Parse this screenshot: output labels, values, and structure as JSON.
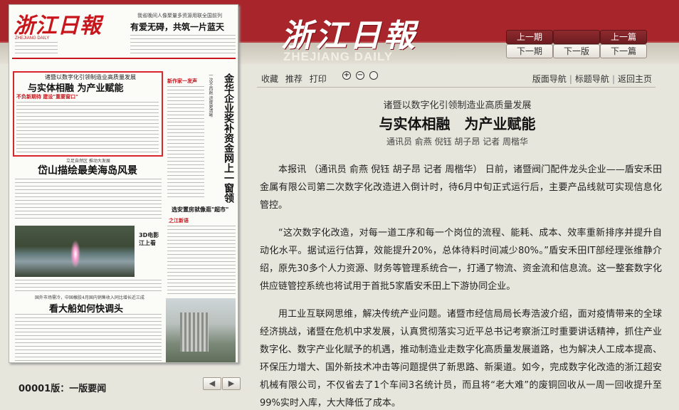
{
  "masthead": {
    "logo_cn": "浙江日報",
    "logo_en": "ZHEJIANG DAILY"
  },
  "nav": {
    "prev_issue": "上一期",
    "next_issue": "下一期",
    "next_page": "下一版",
    "prev_article": "上一篇",
    "next_article": "下一篇"
  },
  "thumbnail": {
    "masthead": "浙江日報",
    "daily_label": "ZHEJIANG DAILY",
    "top_sub": "我省晚间人像聚量多资源用联全国前列",
    "top_head": "有爱无碍，共筑一片蓝天",
    "box_sub": "诸暨以数字化引领制造业高质量发展",
    "box_head": "与实体相融 为产业赋能",
    "box_redsub": "不负新期待 建设\"重要窗口\"",
    "head2_sub": "立足自然区 推动大发展",
    "head2": "岱山描绘最美海岛风景",
    "photo_caption": "3D电影 江上看",
    "head3_sub": "国外市场需冷，中国橡胶4月国内销售收入同比增长近三成",
    "head3": "看大船如何快调头",
    "vert_sub": "一次不再跑 进度更清晰",
    "vert_head": "金华企业奖补资金网上一窗领",
    "tag1": "新作家一发声",
    "tag2": "之江新语",
    "head4": "选安置房就像逛\"超市\""
  },
  "page_label": "00001版：一版要闻",
  "pager": {
    "prev": "◀",
    "next": "▶"
  },
  "toolbar": {
    "favorite": "收藏",
    "recommend": "推荐",
    "print": "打印",
    "zoom_in": "+",
    "zoom_out": "−",
    "zoom_reset": "",
    "page_nav": "版面导航",
    "title_nav": "标题导航",
    "home": "返回主页"
  },
  "article": {
    "subtitle": "诸暨以数字化引领制造业高质量发展",
    "title": "与实体相融　为产业赋能",
    "byline": "通讯员 俞燕 倪钰 胡子昂 记者 周楷华",
    "paragraphs": [
      "本报讯 （通讯员 俞燕 倪钰 胡子昂 记者 周楷华） 日前，诸暨阀门配件龙头企业——盾安禾田金属有限公司第二次数字化改造进入倒计时，待6月中旬正式运行后，主要产品线就可实现信息化管控。",
      "“这次数字化改造，对每一道工序和每一个岗位的流程、能耗、成本、效率重新排序并提升自动化水平。据试运行估算，效能提升20%，总体待料时间减少80%。”盾安禾田IT部经理张维静介绍，原先30多个人力资源、财务等管理系统合一，打通了物流、资金流和信息流。这一整套数字化供应链管控系统也将试用于首批5家盾安禾田上下游协同企业。",
      "用工业互联网思维，解决传统产业问题。诸暨市经信局局长寿浩波介绍，面对疫情带来的全球经济挑战，诸暨在危机中求发展，认真贯彻落实习近平总书记考察浙江时重要讲话精神，抓住产业数字化、数字产业化赋予的机遇，推动制造业走数字化高质量发展道路，也为解决人工成本提高、环保压力增大、国外新技术冲击等问题提供了新思路、新渠道。如今，完成数字化改造的浙江超安机械有限公司，不仅省去了1个车间3名统计员，而且将“老大难”的废铜回收从一周一回收提升至99%实时入库，大大降低了成本。"
    ]
  }
}
